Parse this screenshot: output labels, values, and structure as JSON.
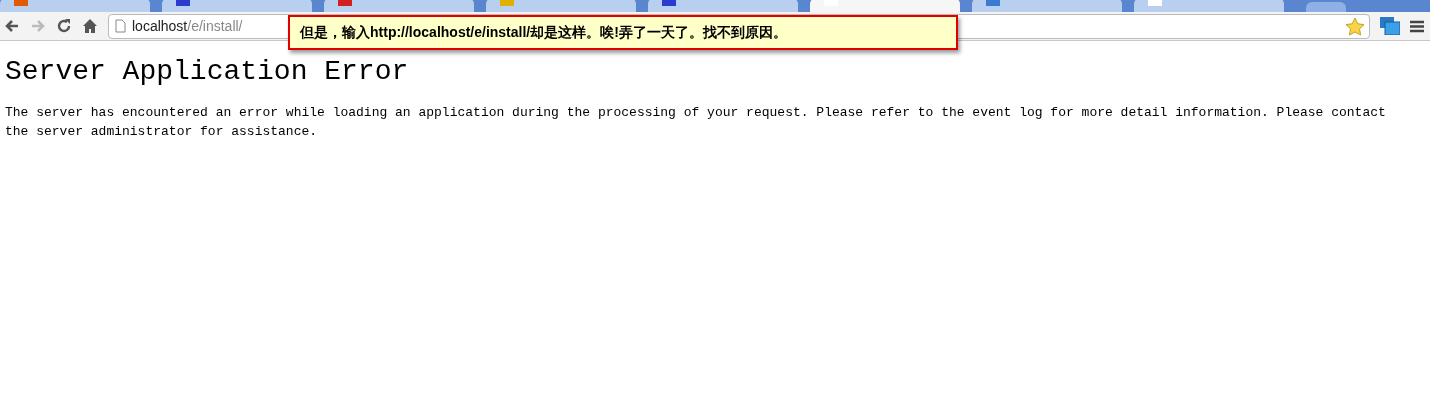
{
  "tabs": [
    {
      "selected": false,
      "color": "#e05a00"
    },
    {
      "selected": false,
      "color": "#2b3bd0"
    },
    {
      "selected": false,
      "color": "#d02020"
    },
    {
      "selected": false,
      "color": "#e0b000"
    },
    {
      "selected": false,
      "color": "#2b3bd0"
    },
    {
      "selected": true,
      "color": "#ffffff"
    },
    {
      "selected": false,
      "color": "#3a7ad0"
    },
    {
      "selected": false,
      "color": "#ffffff"
    }
  ],
  "address_bar": {
    "host": "localhost",
    "path": "/e/install/"
  },
  "annotation": "但是，输入http://localhost/e/install/却是这样。唉!弄了一天了。找不到原因。",
  "page": {
    "heading": "Server Application Error",
    "message": "The server has encountered an error while loading an application during the processing of your request. Please refer to the event log for more detail information. Please contact the server administrator for assistance."
  }
}
